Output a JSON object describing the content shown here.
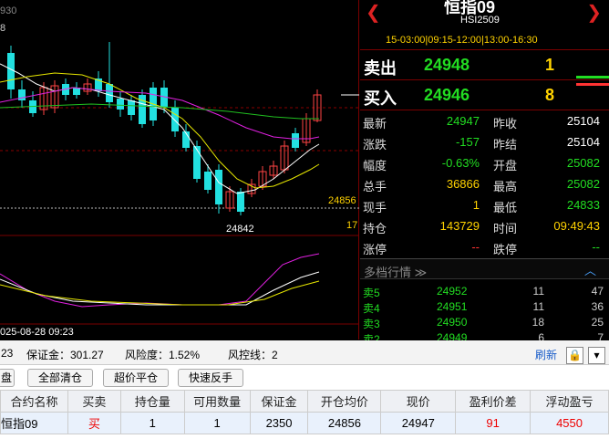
{
  "chart": {
    "time_label_top": "930",
    "left_tick_top": "8",
    "price_marker": "24856",
    "low_label": "24842",
    "right_label": "17",
    "date_label": "025-08-28 09:23",
    "colors": {
      "up": "#ff4444",
      "down": "#22e0e0",
      "ma_white": "#ffffff",
      "ma_yellow": "#e6e600",
      "ma_magenta": "#e020e0",
      "ma_green": "#20c020"
    }
  },
  "quote": {
    "nav_left": "❮",
    "nav_right": "❯",
    "title": "恒指09",
    "code": "HSI2509",
    "sessions": "15-03:00|09:15-12:00|13:00-16:30",
    "ask": {
      "label": "卖出",
      "price": "24948",
      "volume": "1"
    },
    "bid": {
      "label": "买入",
      "price": "24946",
      "volume": "8"
    },
    "stats": [
      {
        "l1": "最新",
        "v1": "24947",
        "c1": "c-green",
        "l2": "昨收",
        "v2": "25104",
        "c2": "c-white"
      },
      {
        "l1": "涨跌",
        "v1": "-157",
        "c1": "c-green",
        "l2": "昨结",
        "v2": "25104",
        "c2": "c-white"
      },
      {
        "l1": "幅度",
        "v1": "-0.63%",
        "c1": "c-green",
        "l2": "开盘",
        "v2": "25082",
        "c2": "c-green"
      },
      {
        "l1": "总手",
        "v1": "36866",
        "c1": "c-yel",
        "l2": "最高",
        "v2": "25082",
        "c2": "c-green"
      },
      {
        "l1": "现手",
        "v1": "1",
        "c1": "c-yel",
        "l2": "最低",
        "v2": "24833",
        "c2": "c-green"
      },
      {
        "l1": "持仓",
        "v1": "143729",
        "c1": "c-yel",
        "l2": "时间",
        "v2": "09:49:43",
        "c2": "c-yel"
      },
      {
        "l1": "涨停",
        "v1": "--",
        "c1": "c-red",
        "l2": "跌停",
        "v2": "--",
        "c2": "c-green"
      }
    ],
    "depth_title": "多档行情 ≫",
    "depth_toggle": "︿",
    "depth": [
      {
        "label": "卖5",
        "price": "24952",
        "vol": "11",
        "extra": "47"
      },
      {
        "label": "卖4",
        "price": "24951",
        "vol": "11",
        "extra": "36"
      },
      {
        "label": "卖3",
        "price": "24950",
        "vol": "18",
        "extra": "25"
      },
      {
        "label": "卖2",
        "price": "24949",
        "vol": "6",
        "extra": "7"
      }
    ]
  },
  "account": {
    "left_text": "23",
    "margin": "保证金：301.27",
    "risk": "风险度：1.52%",
    "control": "风控线：2",
    "refresh": "刷新",
    "lock_icon": "🔒",
    "dropdown_icon": "▾"
  },
  "actions": {
    "b0": "盘",
    "b1": "全部清仓",
    "b2": "超价平仓",
    "b3": "快速反手"
  },
  "positions": {
    "headers": [
      "合约名称",
      "买卖",
      "持仓量",
      "可用数量",
      "保证金",
      "开仓均价",
      "现价",
      "盈利价差",
      "浮动盈亏"
    ],
    "rows": [
      {
        "name": "恒指09",
        "side": "买",
        "qty": "1",
        "avail": "1",
        "margin": "2350",
        "open": "24856",
        "last": "24947",
        "diff": "91",
        "pnl": "4550"
      }
    ]
  }
}
